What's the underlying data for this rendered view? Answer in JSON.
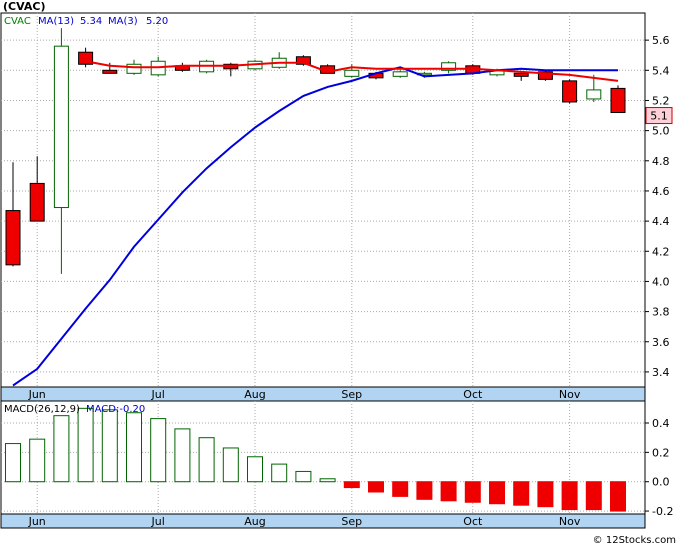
{
  "symbol_label": "(CVAC)",
  "watermark": "© 12Stocks.com",
  "chart_data": [
    {
      "type": "candlestick",
      "legend": [
        {
          "text": "CVAC",
          "color": "#008000"
        },
        {
          "text": "MA(13)",
          "color": "#0000cc"
        },
        {
          "text": "5.34",
          "color": "#0000cc"
        },
        {
          "text": "MA(3)",
          "color": "#0000cc"
        },
        {
          "text": "5.20",
          "color": "#0000cc"
        }
      ],
      "last_price_label": "5.1",
      "y_ticks": [
        "5.6",
        "5.4",
        "5.2",
        "5.0",
        "4.8",
        "4.6",
        "4.4",
        "4.2",
        "4.0",
        "3.8",
        "3.6",
        "3.4"
      ],
      "ylim": [
        3.3,
        5.78
      ],
      "x_ticks": [
        {
          "label": "Jun",
          "week": 1
        },
        {
          "label": "Jul",
          "week": 6
        },
        {
          "label": "Aug",
          "week": 10
        },
        {
          "label": "Sep",
          "week": 14
        },
        {
          "label": "Oct",
          "week": 19
        },
        {
          "label": "Nov",
          "week": 23
        }
      ],
      "candles": [
        {
          "o": 4.47,
          "h": 4.79,
          "l": 4.1,
          "c": 4.11
        },
        {
          "o": 4.65,
          "h": 4.83,
          "l": 4.4,
          "c": 4.4
        },
        {
          "o": 4.49,
          "h": 5.68,
          "l": 4.05,
          "c": 5.56
        },
        {
          "o": 5.52,
          "h": 5.55,
          "l": 5.42,
          "c": 5.44
        },
        {
          "o": 5.4,
          "h": 5.45,
          "l": 5.38,
          "c": 5.38
        },
        {
          "o": 5.38,
          "h": 5.47,
          "l": 5.37,
          "c": 5.44
        },
        {
          "o": 5.37,
          "h": 5.49,
          "l": 5.36,
          "c": 5.46
        },
        {
          "o": 5.43,
          "h": 5.45,
          "l": 5.39,
          "c": 5.4
        },
        {
          "o": 5.39,
          "h": 5.47,
          "l": 5.38,
          "c": 5.46
        },
        {
          "o": 5.44,
          "h": 5.45,
          "l": 5.36,
          "c": 5.41
        },
        {
          "o": 5.41,
          "h": 5.47,
          "l": 5.4,
          "c": 5.46
        },
        {
          "o": 5.42,
          "h": 5.52,
          "l": 5.41,
          "c": 5.48
        },
        {
          "o": 5.49,
          "h": 5.5,
          "l": 5.43,
          "c": 5.44
        },
        {
          "o": 5.43,
          "h": 5.44,
          "l": 5.38,
          "c": 5.38
        },
        {
          "o": 5.36,
          "h": 5.44,
          "l": 5.35,
          "c": 5.4
        },
        {
          "o": 5.38,
          "h": 5.39,
          "l": 5.34,
          "c": 5.35
        },
        {
          "o": 5.36,
          "h": 5.4,
          "l": 5.35,
          "c": 5.39
        },
        {
          "o": 5.37,
          "h": 5.39,
          "l": 5.35,
          "c": 5.38
        },
        {
          "o": 5.4,
          "h": 5.46,
          "l": 5.38,
          "c": 5.45
        },
        {
          "o": 5.43,
          "h": 5.44,
          "l": 5.37,
          "c": 5.38
        },
        {
          "o": 5.37,
          "h": 5.41,
          "l": 5.36,
          "c": 5.4
        },
        {
          "o": 5.38,
          "h": 5.39,
          "l": 5.33,
          "c": 5.36
        },
        {
          "o": 5.39,
          "h": 5.4,
          "l": 5.33,
          "c": 5.34
        },
        {
          "o": 5.33,
          "h": 5.34,
          "l": 5.18,
          "c": 5.19
        },
        {
          "o": 5.21,
          "h": 5.37,
          "l": 5.19,
          "c": 5.27
        },
        {
          "o": 5.28,
          "h": 5.3,
          "l": 5.12,
          "c": 5.12
        }
      ],
      "ma13": [
        3.31,
        3.42,
        3.62,
        3.82,
        4.01,
        4.23,
        4.41,
        4.59,
        4.75,
        4.89,
        5.02,
        5.13,
        5.23,
        5.29,
        5.33,
        5.38,
        5.42,
        5.36,
        5.37,
        5.38,
        5.4,
        5.41,
        5.4,
        5.4,
        5.4,
        5.4
      ],
      "ma3": [
        null,
        null,
        null,
        5.46,
        5.43,
        5.42,
        5.42,
        5.43,
        5.43,
        5.43,
        5.44,
        5.45,
        5.45,
        5.39,
        5.42,
        5.41,
        5.41,
        5.41,
        5.41,
        5.41,
        5.4,
        5.39,
        5.38,
        5.37,
        5.35,
        5.33
      ],
      "colors": {
        "up_fill": "#ffffff",
        "up_stroke": "#006400",
        "down_fill": "#ee0000",
        "down_stroke": "#000000",
        "ma13": "#0000dd",
        "ma3": "#ee0000",
        "axis_band": "#b0d4f1",
        "grid": "#aaaaaa",
        "label_bg": "#ffd0d8"
      }
    },
    {
      "type": "bar",
      "legend": [
        {
          "text": "MACD(26,12,9)",
          "color": "#000000"
        },
        {
          "text": "MACD:-0.20",
          "color": "#0000cc"
        }
      ],
      "y_ticks": [
        "0.4",
        "0.2",
        "0.0",
        "-0.2"
      ],
      "ylim": [
        -0.22,
        0.55
      ],
      "x_ticks": [
        {
          "label": "Jun",
          "week": 1
        },
        {
          "label": "Jul",
          "week": 6
        },
        {
          "label": "Aug",
          "week": 10
        },
        {
          "label": "Sep",
          "week": 14
        },
        {
          "label": "Oct",
          "week": 19
        },
        {
          "label": "Nov",
          "week": 23
        }
      ],
      "values": [
        0.26,
        0.29,
        0.45,
        0.5,
        0.49,
        0.47,
        0.43,
        0.36,
        0.3,
        0.23,
        0.17,
        0.12,
        0.07,
        0.02,
        -0.04,
        -0.07,
        -0.1,
        -0.12,
        -0.13,
        -0.14,
        -0.15,
        -0.16,
        -0.17,
        -0.19,
        -0.19,
        -0.2
      ],
      "colors": {
        "pos_fill": "#ffffff",
        "pos_stroke": "#006400",
        "neg_fill": "#ee0000"
      }
    }
  ]
}
